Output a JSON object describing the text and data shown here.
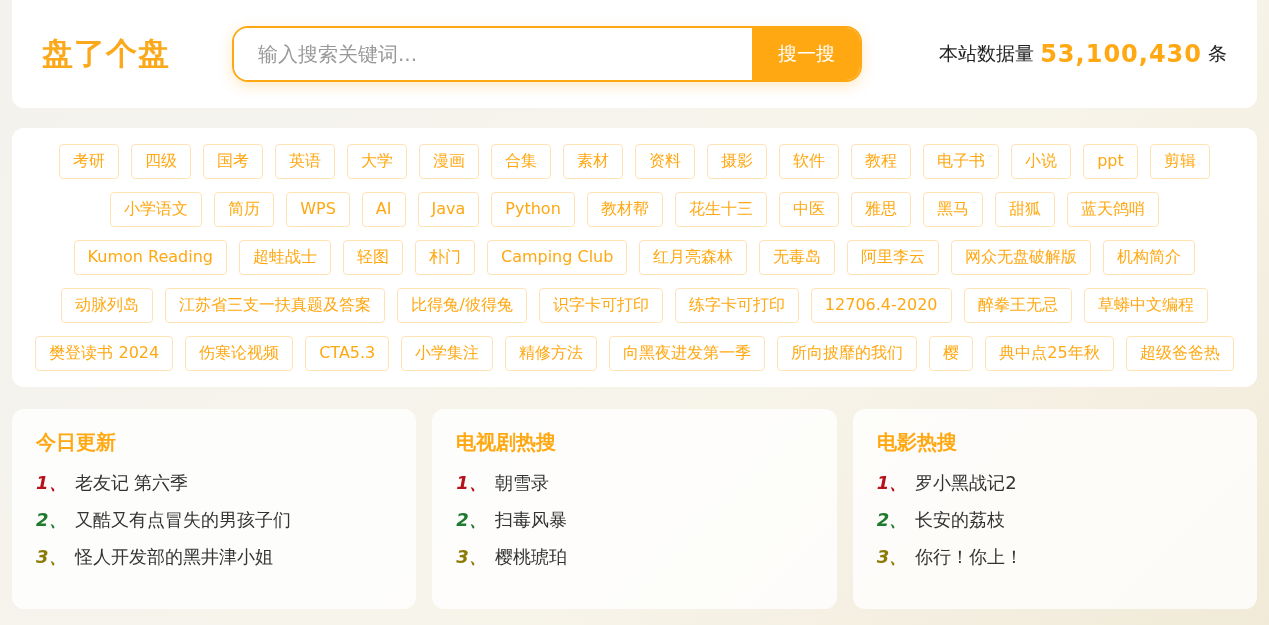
{
  "header": {
    "logo": "盘了个盘",
    "search": {
      "placeholder": "输入搜索关键词...",
      "button": "搜一搜"
    },
    "stats": {
      "prefix": "本站数据量",
      "count": "53,100,430",
      "suffix": "条"
    }
  },
  "tags": [
    "考研",
    "四级",
    "国考",
    "英语",
    "大学",
    "漫画",
    "合集",
    "素材",
    "资料",
    "摄影",
    "软件",
    "教程",
    "电子书",
    "小说",
    "ppt",
    "剪辑",
    "小学语文",
    "简历",
    "WPS",
    "AI",
    "Java",
    "Python",
    "教材帮",
    "花生十三",
    "中医",
    "雅思",
    "黑马",
    "甜狐",
    "蓝天鸽哨",
    "Kumon Reading",
    "超蛙战士",
    "轻图",
    "朴门",
    "Camping Club",
    "红月亮森林",
    "无毒岛",
    "阿里李云",
    "网众无盘破解版",
    "机构简介",
    "动脉列岛",
    "江苏省三支一扶真题及答案",
    "比得兔/彼得兔",
    "识字卡可打印",
    "练字卡可打印",
    "12706.4-2020",
    "醉拳王无忌",
    "草蟒中文编程",
    "樊登读书 2024",
    "伤寒论视频",
    "CTA5.3",
    "小学集注",
    "精修方法",
    "向黑夜进发第一季",
    "所向披靡的我们",
    "樱",
    "典中点25年秋",
    "超级爸爸热"
  ],
  "lists": [
    {
      "title": "今日更新",
      "items": [
        {
          "rank": "1、",
          "color": "#b5121b",
          "title": "老友记 第六季"
        },
        {
          "rank": "2、",
          "color": "#1f7a2e",
          "title": "又酷又有点冒失的男孩子们"
        },
        {
          "rank": "3、",
          "color": "#8c7a06",
          "title": "怪人开发部的黑井津小姐"
        }
      ]
    },
    {
      "title": "电视剧热搜",
      "items": [
        {
          "rank": "1、",
          "color": "#b5121b",
          "title": "朝雪录"
        },
        {
          "rank": "2、",
          "color": "#1f7a2e",
          "title": "扫毒风暴"
        },
        {
          "rank": "3、",
          "color": "#8c7a06",
          "title": "樱桃琥珀"
        }
      ]
    },
    {
      "title": "电影热搜",
      "items": [
        {
          "rank": "1、",
          "color": "#b5121b",
          "title": "罗小黑战记2"
        },
        {
          "rank": "2、",
          "color": "#1f7a2e",
          "title": "长安的荔枝"
        },
        {
          "rank": "3、",
          "color": "#8c7a06",
          "title": "你行！你上！"
        }
      ]
    }
  ]
}
